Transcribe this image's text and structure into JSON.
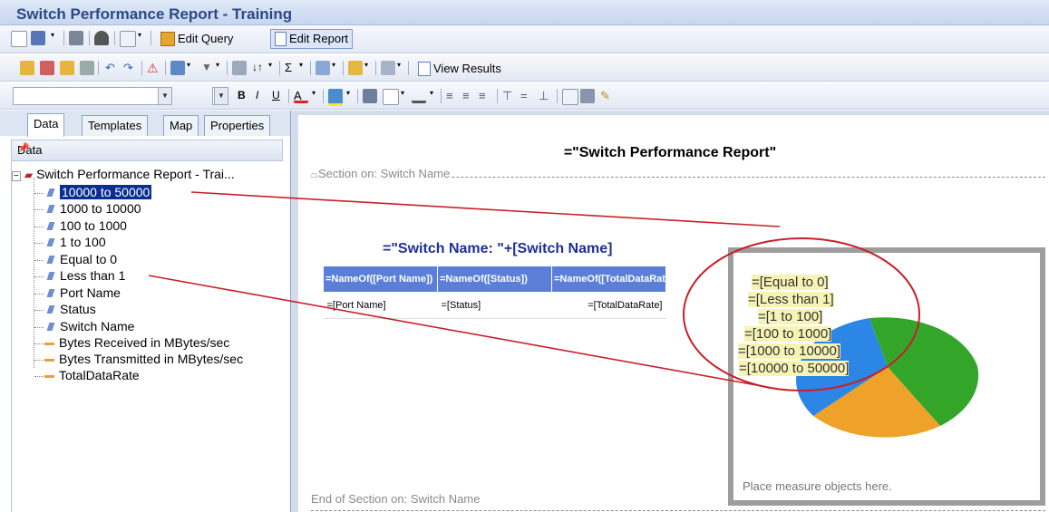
{
  "window": {
    "title": "Switch Performance Report - Training"
  },
  "toolbar": {
    "edit_query": "Edit Query",
    "edit_report": "Edit Report",
    "view_results": "View Results"
  },
  "left_panel": {
    "tabs": [
      "Data",
      "Templates",
      "Map",
      "Properties"
    ],
    "active_tab": "Data",
    "header": "Data",
    "root": "Switch Performance Report - Trai...",
    "dimensions": [
      "10000 to 50000",
      "1000 to 10000",
      "100 to 1000",
      "1 to 100",
      "Equal to 0",
      "Less than 1",
      "Port Name",
      "Status",
      "Switch Name"
    ],
    "measures": [
      "Bytes Received in MBytes/sec",
      "Bytes Transmitted in MBytes/sec",
      "TotalDataRate"
    ],
    "selected": "10000 to 50000"
  },
  "report": {
    "title": "=\"Switch Performance Report\"",
    "section_start": "Section on: Switch Name",
    "section_end": "End of Section on: Switch Name",
    "subtitle": "=\"Switch Name: \"+[Switch Name]",
    "table": {
      "headers": [
        "=NameOf([Port Name])",
        "=NameOf([Status])",
        "=NameOf([TotalDataRate])"
      ],
      "row": [
        "=[Port Name]",
        "=[Status]",
        "=[TotalDataRate]"
      ]
    },
    "chart": {
      "labels": [
        "=[Equal to 0]",
        "=[Less than 1]",
        "=[1 to 100]",
        "=[100 to 1000]",
        "=[1000 to 10000]",
        "=[10000 to 50000]"
      ],
      "placeholder": "Place measure objects here.",
      "colors": {
        "green": "#33a62a",
        "orange": "#efa22a",
        "blue": "#2b86e6"
      }
    }
  },
  "annotation": {
    "color": "#c8202a"
  }
}
